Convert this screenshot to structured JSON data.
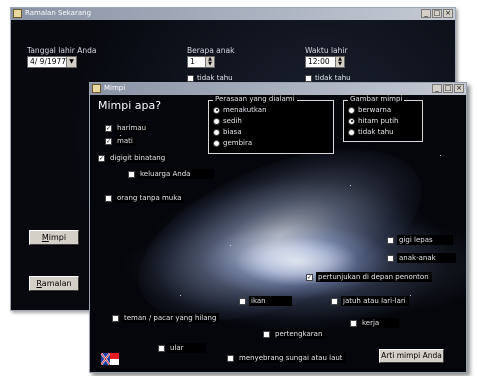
{
  "back_window": {
    "title": "Ramalan Sekarang",
    "birth_date_label": "Tanggal lahir Anda",
    "birth_date_value": "4/ 9/1977",
    "children_label": "Berapa anak",
    "children_value": "1",
    "children_unknown": "tidak tahu",
    "birth_time_label": "Waktu lahir",
    "birth_time_value": "12:00",
    "time_unknown": "tidak tahu",
    "mimpi_button": "Mimpi",
    "ramalan_button": "Ramalan",
    "mimpi_underline": "M",
    "mimpi_rest": "impi",
    "ramalan_underline": "R",
    "ramalan_rest": "amalan"
  },
  "front_window": {
    "title": "Mimpi",
    "heading": "Mimpi apa?",
    "feelings_title": "Perasaan yang dialami",
    "feelings": [
      "menakutkan",
      "sedih",
      "biasa",
      "gembira"
    ],
    "feelings_selected": 0,
    "picture_title": "Gambar mimpi",
    "picture": [
      "berwarna",
      "hitam putih",
      "tidak tahu"
    ],
    "picture_selected": 1,
    "items": {
      "harimau": "harimau",
      "mati": "mati",
      "digigit": "digigit binatang",
      "keluarga": "keluarga Anda",
      "orang": "orang tanpa muka",
      "gigi": "gigi lepas",
      "anak": "anak-anak",
      "pertunjukan": "pertunjukan di depan penonton",
      "ikan": "ikan",
      "jatuh": "jatuh atau lari-lari",
      "teman": "teman / pacar yang hilang",
      "kerja": "kerja",
      "pertengkaran": "pertengkaran",
      "ular": "ular",
      "menyebrang": "menyebrang sungai atau laut"
    },
    "checked": [
      "harimau",
      "mati",
      "digigit",
      "pertunjukan"
    ],
    "arti_button": "Arti mimpi Anda"
  },
  "window_buttons": {
    "minimize": "_",
    "maximize": "□",
    "close": "×"
  },
  "colors": {
    "titlebar": "#8a93a6",
    "space": "#04060b",
    "button": "#d4d0c8"
  }
}
